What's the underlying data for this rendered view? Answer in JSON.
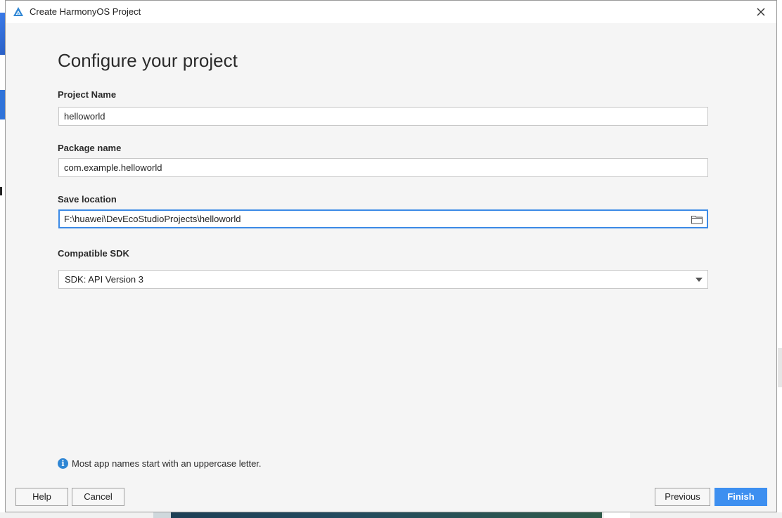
{
  "window": {
    "title": "Create HarmonyOS Project"
  },
  "page": {
    "heading": "Configure your project"
  },
  "form": {
    "project_name": {
      "label": "Project Name",
      "value": "helloworld"
    },
    "package_name": {
      "label": "Package name",
      "value": "com.example.helloworld"
    },
    "save_location": {
      "label": "Save location",
      "value": "F:\\huawei\\DevEcoStudioProjects\\helloworld"
    },
    "compatible_sdk": {
      "label": "Compatible SDK",
      "selected": "SDK: API Version 3"
    }
  },
  "hint": {
    "text": "Most app names start with an uppercase letter.",
    "icon_glyph": "i"
  },
  "buttons": {
    "help": "Help",
    "cancel": "Cancel",
    "previous": "Previous",
    "finish": "Finish"
  },
  "colors": {
    "accent": "#3d8ff0",
    "focus_border": "#3b8ae6",
    "info": "#2f86d4"
  }
}
